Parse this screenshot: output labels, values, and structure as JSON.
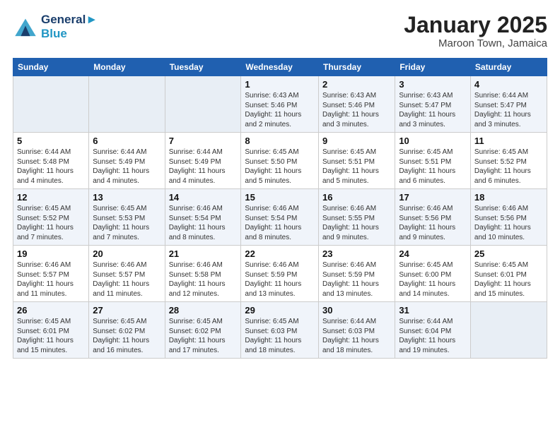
{
  "header": {
    "logo_line1": "General",
    "logo_line2": "Blue",
    "month": "January 2025",
    "location": "Maroon Town, Jamaica"
  },
  "weekdays": [
    "Sunday",
    "Monday",
    "Tuesday",
    "Wednesday",
    "Thursday",
    "Friday",
    "Saturday"
  ],
  "weeks": [
    [
      {
        "day": "",
        "info": ""
      },
      {
        "day": "",
        "info": ""
      },
      {
        "day": "",
        "info": ""
      },
      {
        "day": "1",
        "info": "Sunrise: 6:43 AM\nSunset: 5:46 PM\nDaylight: 11 hours\nand 2 minutes."
      },
      {
        "day": "2",
        "info": "Sunrise: 6:43 AM\nSunset: 5:46 PM\nDaylight: 11 hours\nand 3 minutes."
      },
      {
        "day": "3",
        "info": "Sunrise: 6:43 AM\nSunset: 5:47 PM\nDaylight: 11 hours\nand 3 minutes."
      },
      {
        "day": "4",
        "info": "Sunrise: 6:44 AM\nSunset: 5:47 PM\nDaylight: 11 hours\nand 3 minutes."
      }
    ],
    [
      {
        "day": "5",
        "info": "Sunrise: 6:44 AM\nSunset: 5:48 PM\nDaylight: 11 hours\nand 4 minutes."
      },
      {
        "day": "6",
        "info": "Sunrise: 6:44 AM\nSunset: 5:49 PM\nDaylight: 11 hours\nand 4 minutes."
      },
      {
        "day": "7",
        "info": "Sunrise: 6:44 AM\nSunset: 5:49 PM\nDaylight: 11 hours\nand 4 minutes."
      },
      {
        "day": "8",
        "info": "Sunrise: 6:45 AM\nSunset: 5:50 PM\nDaylight: 11 hours\nand 5 minutes."
      },
      {
        "day": "9",
        "info": "Sunrise: 6:45 AM\nSunset: 5:51 PM\nDaylight: 11 hours\nand 5 minutes."
      },
      {
        "day": "10",
        "info": "Sunrise: 6:45 AM\nSunset: 5:51 PM\nDaylight: 11 hours\nand 6 minutes."
      },
      {
        "day": "11",
        "info": "Sunrise: 6:45 AM\nSunset: 5:52 PM\nDaylight: 11 hours\nand 6 minutes."
      }
    ],
    [
      {
        "day": "12",
        "info": "Sunrise: 6:45 AM\nSunset: 5:52 PM\nDaylight: 11 hours\nand 7 minutes."
      },
      {
        "day": "13",
        "info": "Sunrise: 6:45 AM\nSunset: 5:53 PM\nDaylight: 11 hours\nand 7 minutes."
      },
      {
        "day": "14",
        "info": "Sunrise: 6:46 AM\nSunset: 5:54 PM\nDaylight: 11 hours\nand 8 minutes."
      },
      {
        "day": "15",
        "info": "Sunrise: 6:46 AM\nSunset: 5:54 PM\nDaylight: 11 hours\nand 8 minutes."
      },
      {
        "day": "16",
        "info": "Sunrise: 6:46 AM\nSunset: 5:55 PM\nDaylight: 11 hours\nand 9 minutes."
      },
      {
        "day": "17",
        "info": "Sunrise: 6:46 AM\nSunset: 5:56 PM\nDaylight: 11 hours\nand 9 minutes."
      },
      {
        "day": "18",
        "info": "Sunrise: 6:46 AM\nSunset: 5:56 PM\nDaylight: 11 hours\nand 10 minutes."
      }
    ],
    [
      {
        "day": "19",
        "info": "Sunrise: 6:46 AM\nSunset: 5:57 PM\nDaylight: 11 hours\nand 11 minutes."
      },
      {
        "day": "20",
        "info": "Sunrise: 6:46 AM\nSunset: 5:57 PM\nDaylight: 11 hours\nand 11 minutes."
      },
      {
        "day": "21",
        "info": "Sunrise: 6:46 AM\nSunset: 5:58 PM\nDaylight: 11 hours\nand 12 minutes."
      },
      {
        "day": "22",
        "info": "Sunrise: 6:46 AM\nSunset: 5:59 PM\nDaylight: 11 hours\nand 13 minutes."
      },
      {
        "day": "23",
        "info": "Sunrise: 6:46 AM\nSunset: 5:59 PM\nDaylight: 11 hours\nand 13 minutes."
      },
      {
        "day": "24",
        "info": "Sunrise: 6:45 AM\nSunset: 6:00 PM\nDaylight: 11 hours\nand 14 minutes."
      },
      {
        "day": "25",
        "info": "Sunrise: 6:45 AM\nSunset: 6:01 PM\nDaylight: 11 hours\nand 15 minutes."
      }
    ],
    [
      {
        "day": "26",
        "info": "Sunrise: 6:45 AM\nSunset: 6:01 PM\nDaylight: 11 hours\nand 15 minutes."
      },
      {
        "day": "27",
        "info": "Sunrise: 6:45 AM\nSunset: 6:02 PM\nDaylight: 11 hours\nand 16 minutes."
      },
      {
        "day": "28",
        "info": "Sunrise: 6:45 AM\nSunset: 6:02 PM\nDaylight: 11 hours\nand 17 minutes."
      },
      {
        "day": "29",
        "info": "Sunrise: 6:45 AM\nSunset: 6:03 PM\nDaylight: 11 hours\nand 18 minutes."
      },
      {
        "day": "30",
        "info": "Sunrise: 6:44 AM\nSunset: 6:03 PM\nDaylight: 11 hours\nand 18 minutes."
      },
      {
        "day": "31",
        "info": "Sunrise: 6:44 AM\nSunset: 6:04 PM\nDaylight: 11 hours\nand 19 minutes."
      },
      {
        "day": "",
        "info": ""
      }
    ]
  ]
}
